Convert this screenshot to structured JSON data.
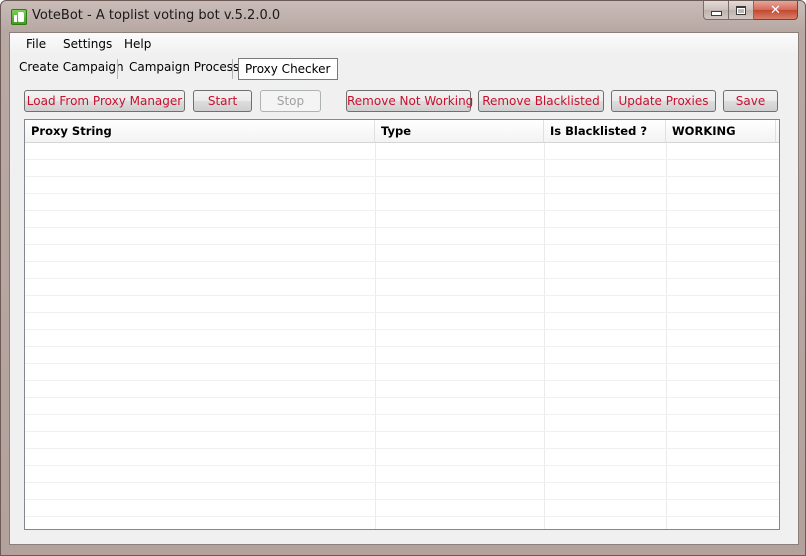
{
  "window": {
    "title": "VoteBot - A toplist voting bot v.5.2.0.0",
    "icon": "app-icon"
  },
  "menu": {
    "items": [
      "File",
      "Settings",
      "Help"
    ]
  },
  "tabs": [
    {
      "label": "Create Campaign",
      "active": false
    },
    {
      "label": "Campaign Process",
      "active": false
    },
    {
      "label": "Proxy Checker",
      "active": true
    }
  ],
  "toolbar": {
    "load_label": "Load From Proxy Manager",
    "start_label": "Start",
    "stop_label": "Stop",
    "remove_not_working_label": "Remove Not Working",
    "remove_blacklisted_label": "Remove Blacklisted",
    "update_proxies_label": "Update Proxies",
    "save_label": "Save"
  },
  "grid": {
    "columns": [
      "Proxy String",
      "Type",
      "Is Blacklisted ?",
      "WORKING"
    ],
    "rows": []
  },
  "colors": {
    "button_text": "#c8102e",
    "disabled_text": "#a0a0a0"
  }
}
